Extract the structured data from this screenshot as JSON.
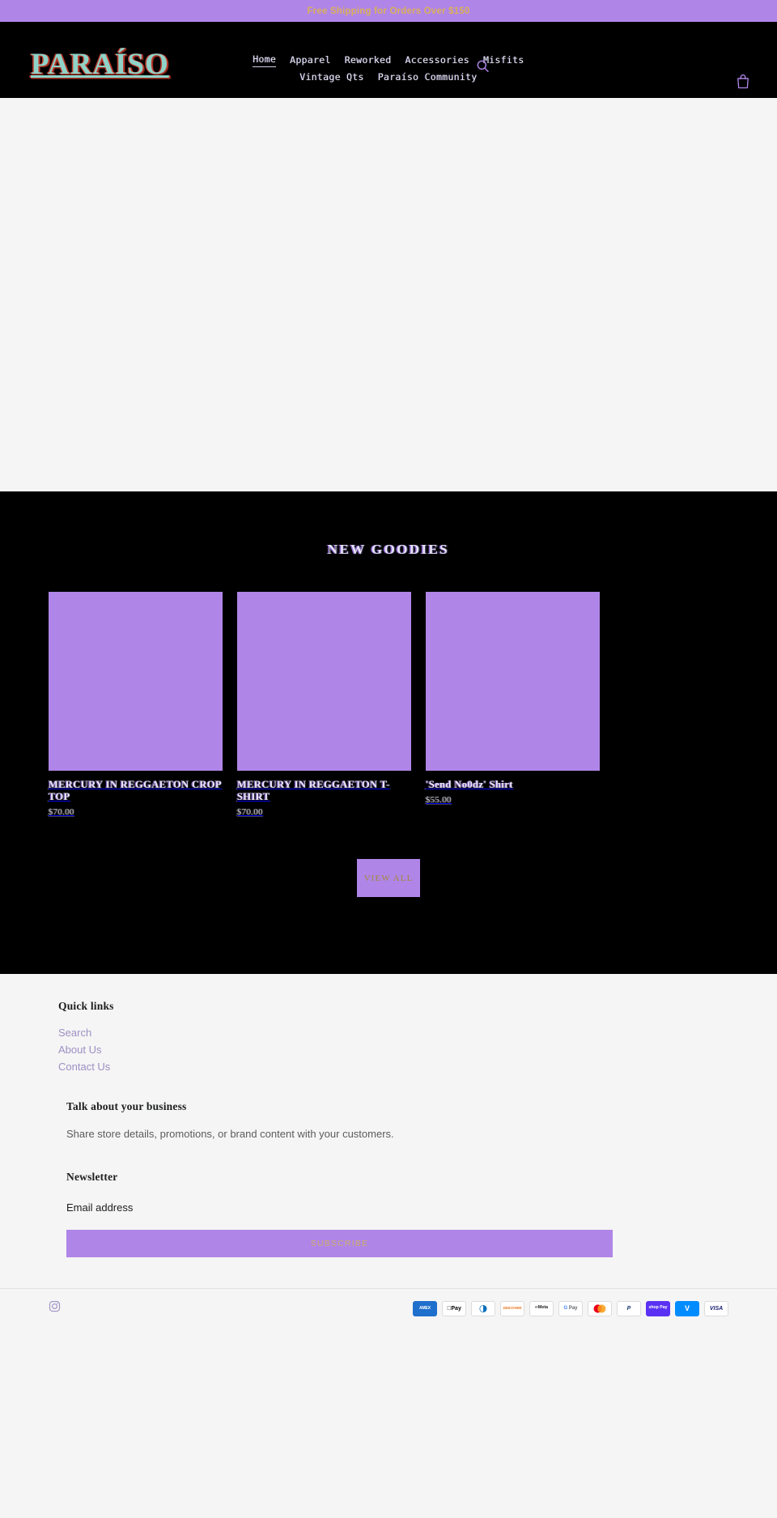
{
  "announcement": {
    "text": "Free Shipping for Orders Over $150",
    "bg_color": "#b085e8",
    "text_color": "#d9b05a"
  },
  "header": {
    "logo": "PARAÍSO",
    "logo_fill_color": "#8fd3c8",
    "logo_outline_color": "#c0392b",
    "search_icon": "search-icon",
    "cart_icon": "cart-icon",
    "nav_row_1": [
      {
        "label": "Home",
        "active": true
      },
      {
        "label": "Apparel",
        "active": false
      },
      {
        "label": "Reworked",
        "active": false
      },
      {
        "label": "Accessories",
        "active": false
      },
      {
        "label": "Misfits",
        "active": false
      }
    ],
    "nav_row_2": [
      {
        "label": "Vintage Qts",
        "active": false
      },
      {
        "label": "Paraíso Community",
        "active": false
      }
    ]
  },
  "goodies": {
    "title": "NEW GOODIES",
    "bg_color": "#000000",
    "accent_color": "#b085e8",
    "products": [
      {
        "title": "MERCURY IN REGGAETON CROP TOP",
        "price": "$70.00"
      },
      {
        "title": "MERCURY IN REGGAETON T-SHIRT",
        "price": "$70.00"
      },
      {
        "title": "'Send No0dz' Shirt",
        "price": "$55.00"
      }
    ],
    "view_all_label": "VIEW ALL"
  },
  "footer": {
    "quick_links_heading": "Quick links",
    "quick_links": [
      {
        "label": "Search"
      },
      {
        "label": "About Us"
      },
      {
        "label": "Contact Us"
      }
    ],
    "business_heading": "Talk about your business",
    "business_text": "Share store details, promotions, or brand content with your customers.",
    "newsletter_heading": "Newsletter",
    "email_label": "Email address",
    "email_value": "",
    "email_placeholder": "",
    "subscribe_label": "SUBSCRIBE",
    "social": [
      {
        "name": "instagram-icon"
      }
    ],
    "payment_methods": [
      {
        "name": "amex",
        "label": "AMEX"
      },
      {
        "name": "apple-pay",
        "label": "Pay"
      },
      {
        "name": "diners-club",
        "label": ""
      },
      {
        "name": "discover",
        "label": "DISCOVER"
      },
      {
        "name": "meta-pay",
        "label": "Meta"
      },
      {
        "name": "google-pay",
        "label": "Pay"
      },
      {
        "name": "mastercard",
        "label": ""
      },
      {
        "name": "paypal",
        "label": "P"
      },
      {
        "name": "shop-pay",
        "label": "shop Pay"
      },
      {
        "name": "venmo",
        "label": "V"
      },
      {
        "name": "visa",
        "label": "VISA"
      }
    ]
  }
}
